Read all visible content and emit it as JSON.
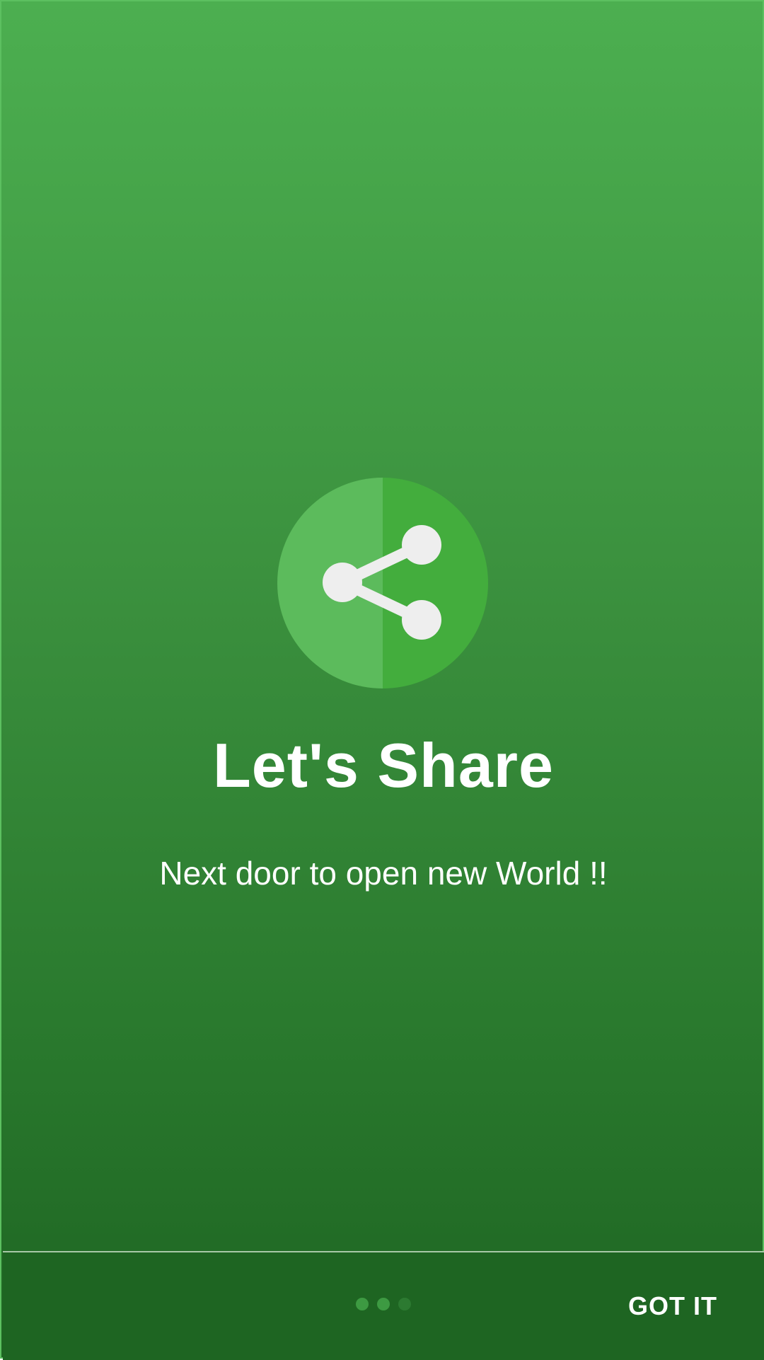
{
  "intro": {
    "title": "Let's Share",
    "subtitle": "Next door to open new World !!",
    "icon": "share-icon"
  },
  "pager": {
    "total_pages": 3,
    "current_page": 3
  },
  "bottom_bar": {
    "done_label": "GOT IT"
  },
  "colors": {
    "gradient_top": "#4CAF50",
    "gradient_bottom": "#1E6522",
    "icon_left": "#5CBB5C",
    "icon_right": "#43AD3D",
    "share_glyph": "#EEEEEE"
  }
}
